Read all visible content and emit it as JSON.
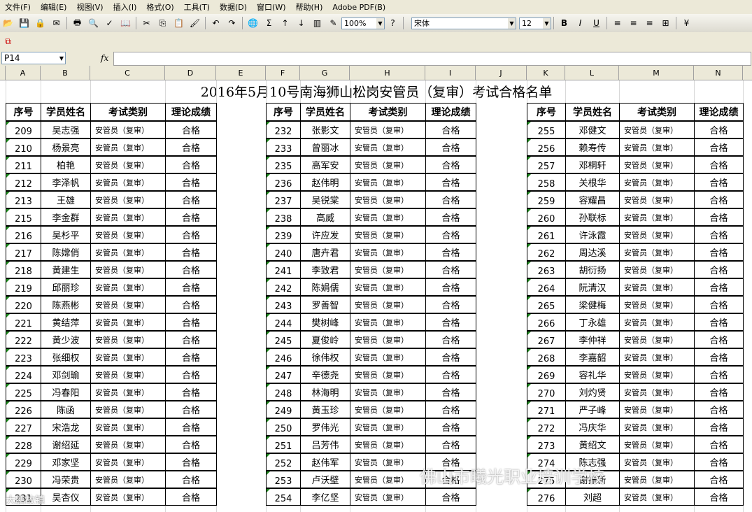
{
  "menu": [
    "文件(F)",
    "编辑(E)",
    "视图(V)",
    "插入(I)",
    "格式(O)",
    "工具(T)",
    "数据(D)",
    "窗口(W)",
    "帮助(H)",
    "Adobe PDF(B)"
  ],
  "toolbar": {
    "zoom": "100%",
    "font": "宋体",
    "font_size": "12"
  },
  "formula": {
    "cell_ref": "P14",
    "fx": "fx",
    "value": ""
  },
  "columns": [
    "A",
    "B",
    "C",
    "D",
    "E",
    "F",
    "G",
    "H",
    "I",
    "J",
    "K",
    "L",
    "M",
    "N"
  ],
  "sheet": {
    "title": "2016年5月10号南海狮山松岗安管员（复审）考试合格名单",
    "headers": [
      "序号",
      "学员姓名",
      "考试类别",
      "理论成绩"
    ],
    "exam_type": "安管员（复审）",
    "result": "合格",
    "groups": [
      {
        "rows": [
          [
            "209",
            "吴志强"
          ],
          [
            "210",
            "杨景亮"
          ],
          [
            "211",
            "柏艳"
          ],
          [
            "212",
            "李泽帆"
          ],
          [
            "213",
            "王雄"
          ],
          [
            "215",
            "李金群"
          ],
          [
            "216",
            "吴杉平"
          ],
          [
            "217",
            "陈嫦俏"
          ],
          [
            "218",
            "黄建生"
          ],
          [
            "219",
            "邱丽珍"
          ],
          [
            "220",
            "陈燕彬"
          ],
          [
            "221",
            "黄结萍"
          ],
          [
            "222",
            "黄少波"
          ],
          [
            "223",
            "张细权"
          ],
          [
            "224",
            "邓剑瑜"
          ],
          [
            "225",
            "冯春阳"
          ],
          [
            "226",
            "陈函"
          ],
          [
            "227",
            "宋浩龙"
          ],
          [
            "228",
            "谢绍延"
          ],
          [
            "229",
            "邓家坚"
          ],
          [
            "230",
            "冯荣贵"
          ],
          [
            "231",
            "吴杏仪"
          ]
        ]
      },
      {
        "rows": [
          [
            "232",
            "张影文"
          ],
          [
            "233",
            "曾丽冰"
          ],
          [
            "235",
            "高军安"
          ],
          [
            "236",
            "赵伟明"
          ],
          [
            "237",
            "吴锐棠"
          ],
          [
            "238",
            "高威"
          ],
          [
            "239",
            "许应发"
          ],
          [
            "240",
            "唐卉君"
          ],
          [
            "241",
            "李致君"
          ],
          [
            "242",
            "陈娟儒"
          ],
          [
            "243",
            "罗善智"
          ],
          [
            "244",
            "樊树峰"
          ],
          [
            "245",
            "夏俊岭"
          ],
          [
            "246",
            "徐伟权"
          ],
          [
            "247",
            "辛德尧"
          ],
          [
            "248",
            "林海明"
          ],
          [
            "249",
            "黄玉珍"
          ],
          [
            "250",
            "罗伟光"
          ],
          [
            "251",
            "吕芳伟"
          ],
          [
            "252",
            "赵伟军"
          ],
          [
            "253",
            "卢沃壁"
          ],
          [
            "254",
            "李亿坚"
          ]
        ]
      },
      {
        "rows": [
          [
            "255",
            "邓健文"
          ],
          [
            "256",
            "赖寿传"
          ],
          [
            "257",
            "邓桐轩"
          ],
          [
            "258",
            "关根华"
          ],
          [
            "259",
            "容耀昌"
          ],
          [
            "260",
            "孙联标"
          ],
          [
            "261",
            "许泳霞"
          ],
          [
            "262",
            "周达溪"
          ],
          [
            "263",
            "胡衍扬"
          ],
          [
            "264",
            "阮清汉"
          ],
          [
            "265",
            "梁健梅"
          ],
          [
            "266",
            "丁永雄"
          ],
          [
            "267",
            "李仲祥"
          ],
          [
            "268",
            "李嘉韶"
          ],
          [
            "269",
            "容礼华"
          ],
          [
            "270",
            "刘灼贤"
          ],
          [
            "271",
            "严子峰"
          ],
          [
            "272",
            "冯庆华"
          ],
          [
            "273",
            "黄绍文"
          ],
          [
            "274",
            "陈志强"
          ],
          [
            "275",
            "谢振新"
          ],
          [
            "276",
            "刘超"
          ]
        ]
      }
    ]
  },
  "watermark": {
    "main": "佛山市曦光职业培训学校",
    "corner": "大鹏故镇"
  }
}
